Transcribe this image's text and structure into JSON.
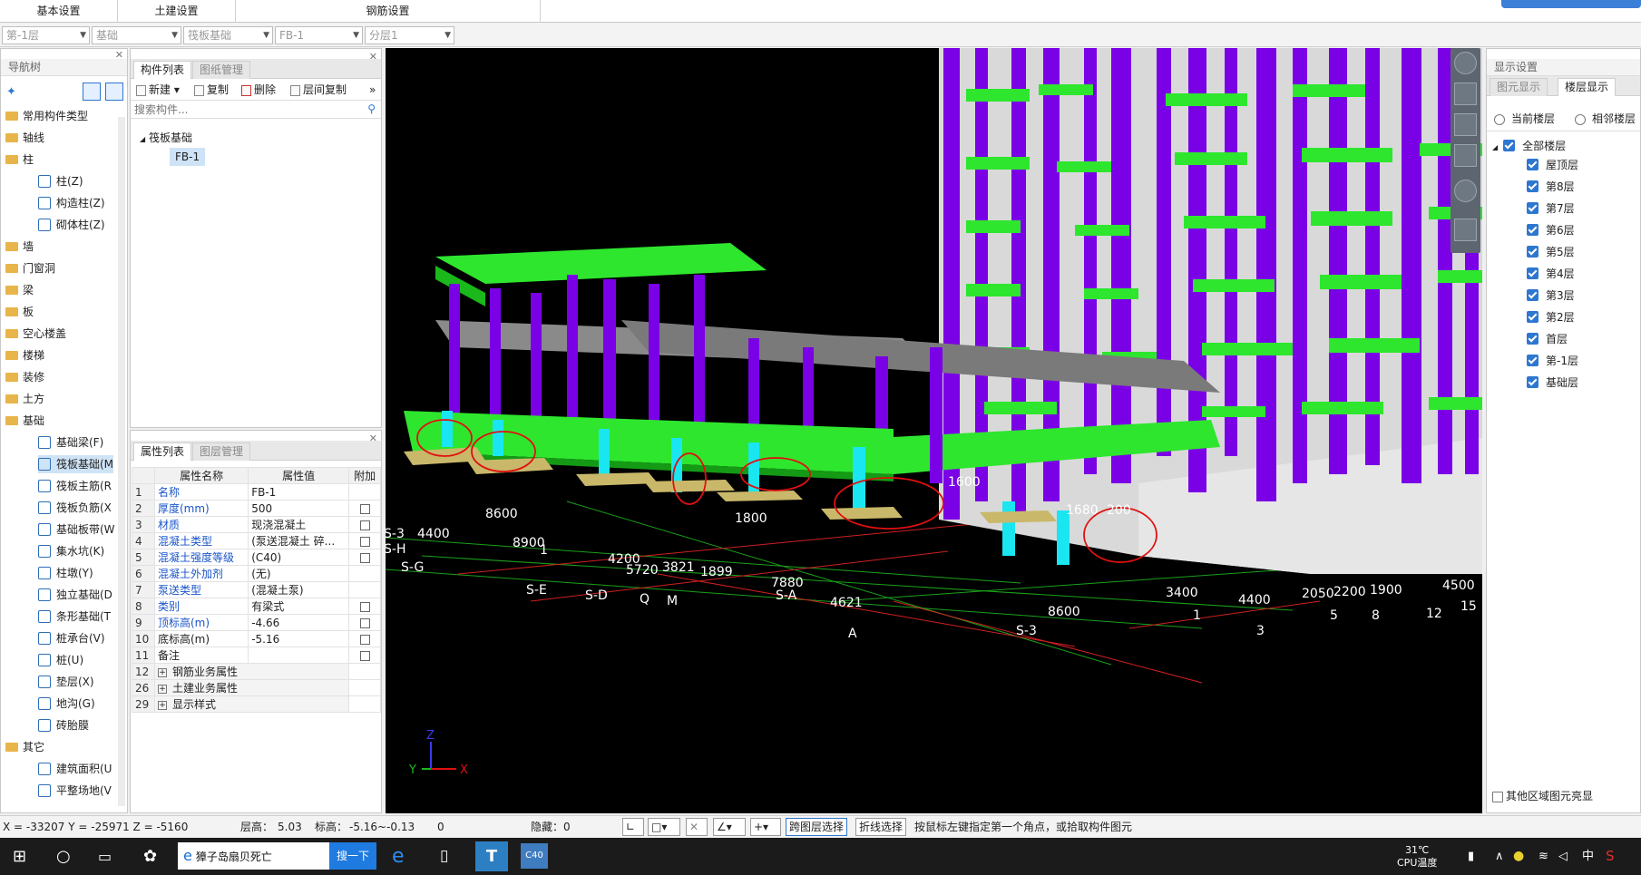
{
  "topbar": {
    "groups": [
      "基本设置",
      "土建设置",
      "钢筋设置"
    ]
  },
  "selectors": [
    "第-1层",
    "基础",
    "筏板基础",
    "FB-1",
    "分层1"
  ],
  "nav": {
    "title": "导航树",
    "items": [
      {
        "label": "常用构件类型",
        "type": "folder"
      },
      {
        "label": "轴线",
        "type": "folder"
      },
      {
        "label": "柱",
        "type": "folder"
      },
      {
        "label": "柱(Z)",
        "type": "sub"
      },
      {
        "label": "构造柱(Z)",
        "type": "sub"
      },
      {
        "label": "砌体柱(Z)",
        "type": "sub"
      },
      {
        "label": "墙",
        "type": "folder"
      },
      {
        "label": "门窗洞",
        "type": "folder"
      },
      {
        "label": "梁",
        "type": "folder"
      },
      {
        "label": "板",
        "type": "folder"
      },
      {
        "label": "空心楼盖",
        "type": "folder"
      },
      {
        "label": "楼梯",
        "type": "folder"
      },
      {
        "label": "装修",
        "type": "folder"
      },
      {
        "label": "土方",
        "type": "folder"
      },
      {
        "label": "基础",
        "type": "folder"
      },
      {
        "label": "基础梁(F)",
        "type": "sub"
      },
      {
        "label": "筏板基础(M",
        "type": "sub"
      },
      {
        "label": "筏板主筋(R",
        "type": "sub"
      },
      {
        "label": "筏板负筋(X",
        "type": "sub"
      },
      {
        "label": "基础板带(W",
        "type": "sub"
      },
      {
        "label": "集水坑(K)",
        "type": "sub"
      },
      {
        "label": "柱墩(Y)",
        "type": "sub"
      },
      {
        "label": "独立基础(D",
        "type": "sub"
      },
      {
        "label": "条形基础(T",
        "type": "sub"
      },
      {
        "label": "桩承台(V)",
        "type": "sub"
      },
      {
        "label": "桩(U)",
        "type": "sub"
      },
      {
        "label": "垫层(X)",
        "type": "sub"
      },
      {
        "label": "地沟(G)",
        "type": "sub"
      },
      {
        "label": "砖胎膜",
        "type": "sub"
      },
      {
        "label": "其它",
        "type": "folder"
      },
      {
        "label": "建筑面积(U",
        "type": "sub"
      },
      {
        "label": "平整场地(V",
        "type": "sub"
      }
    ]
  },
  "component_list": {
    "tabs": [
      "构件列表",
      "图纸管理"
    ],
    "toolbar": {
      "new": "新建",
      "copy": "复制",
      "delete": "删除",
      "floor_copy": "层间复制"
    },
    "search_placeholder": "搜索构件...",
    "tree": {
      "parent": "筏板基础",
      "child": "FB-1"
    }
  },
  "properties": {
    "tabs": [
      "属性列表",
      "图层管理"
    ],
    "headers": [
      "属性名称",
      "属性值",
      "附加"
    ],
    "rows": [
      {
        "n": "1",
        "name": "名称",
        "value": "FB-1",
        "check": false
      },
      {
        "n": "2",
        "name": "厚度(mm)",
        "value": "500",
        "check": true
      },
      {
        "n": "3",
        "name": "材质",
        "value": "现浇混凝土",
        "check": true
      },
      {
        "n": "4",
        "name": "混凝土类型",
        "value": "(泵送混凝土 碎...",
        "check": true
      },
      {
        "n": "5",
        "name": "混凝土强度等级",
        "value": "(C40)",
        "check": true
      },
      {
        "n": "6",
        "name": "混凝土外加剂",
        "value": "(无)",
        "check": false
      },
      {
        "n": "7",
        "name": "泵送类型",
        "value": "(混凝土泵)",
        "check": false
      },
      {
        "n": "8",
        "name": "类别",
        "value": "有梁式",
        "check": true
      },
      {
        "n": "9",
        "name": "顶标高(m)",
        "value": "-4.66",
        "check": true
      },
      {
        "n": "10",
        "name": "底标高(m)",
        "value": "-5.16",
        "check": true
      },
      {
        "n": "11",
        "name": "备注",
        "value": "",
        "check": true
      }
    ],
    "groups": [
      {
        "n": "12",
        "name": "钢筋业务属性"
      },
      {
        "n": "26",
        "name": "土建业务属性"
      },
      {
        "n": "29",
        "name": "显示样式"
      }
    ]
  },
  "viewport": {
    "labels": [
      "8600",
      "8900",
      "4200",
      "5720",
      "3821",
      "1899",
      "7880",
      "4621",
      "8600",
      "3400",
      "4400",
      "2050",
      "2200",
      "1900",
      "4500",
      "4400",
      "1600",
      "1680",
      "200",
      "1800",
      "S-3",
      "S-H",
      "S-G",
      "S-E",
      "S-D",
      "Q",
      "M",
      "S-A",
      "A",
      "S-3",
      "1",
      "3",
      "5",
      "8",
      "12",
      "15",
      "1"
    ],
    "axes": [
      "Z",
      "Y",
      "X"
    ]
  },
  "display_settings": {
    "title": "显示设置",
    "tabs": [
      "图元显示",
      "楼层显示"
    ],
    "radios": [
      "当前楼层",
      "相邻楼层"
    ],
    "all_floors": "全部楼层",
    "floors": [
      "屋顶层",
      "第8层",
      "第7层",
      "第6层",
      "第5层",
      "第4层",
      "第3层",
      "第2层",
      "首层",
      "第-1层",
      "基础层"
    ],
    "footer": "其他区域图元亮显"
  },
  "status": {
    "coords": "X = -33207 Y = -25971 Z = -5160",
    "layer_height_label": "层高：",
    "layer_height": "5.03",
    "elev_label": "标高：",
    "elev": "-5.16~-0.13",
    "zero": "0",
    "hidden": "隐藏：0",
    "cross_layer": "跨图层选择",
    "polyline": "折线选择",
    "hint": "按鼠标左键指定第一个角点，或拾取构件图元"
  },
  "taskbar": {
    "search_text": "獐子岛扇贝死亡",
    "search_btn": "搜一下",
    "cpu_temp": "31℃",
    "cpu_label": "CPU温度",
    "ime": "中",
    "app_badge": "C40"
  },
  "colors": {
    "accent": "#2e77d0",
    "slab_green": "#2ee62e",
    "column_purple": "#7a00e6",
    "cyan": "#19e6f0"
  }
}
